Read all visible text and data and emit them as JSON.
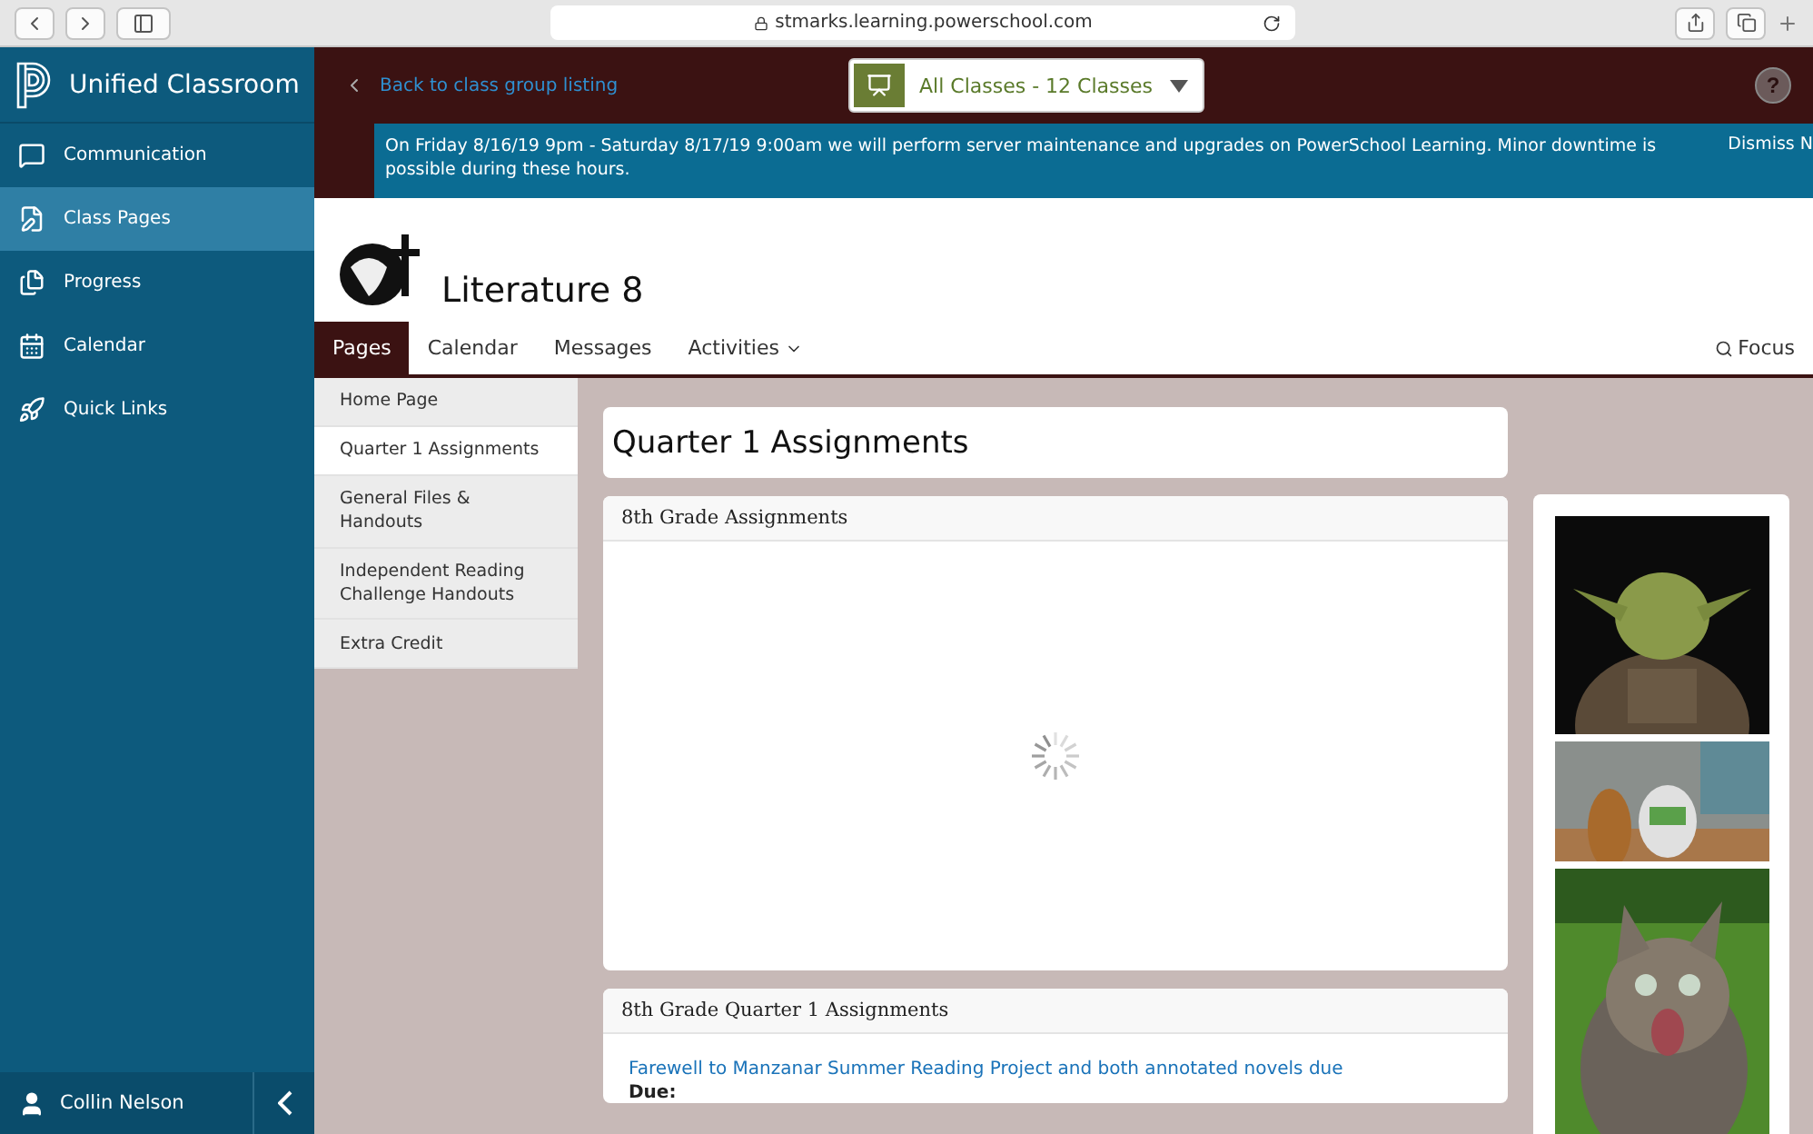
{
  "browser": {
    "url": "stmarks.learning.powerschool.com"
  },
  "sidebar": {
    "title": "Unified Classroom",
    "items": [
      {
        "label": "Communication",
        "selected": false
      },
      {
        "label": "Class Pages",
        "selected": true
      },
      {
        "label": "Progress",
        "selected": false
      },
      {
        "label": "Calendar",
        "selected": false
      },
      {
        "label": "Quick Links",
        "selected": false
      }
    ],
    "user": "Collin Nelson"
  },
  "topbar": {
    "back_link": "Back to class group listing",
    "class_picker": "All Classes - 12 Classes",
    "help": "?"
  },
  "banner": {
    "message": "On Friday 8/16/19 9pm - Saturday 8/17/19 9:00am we will perform server maintenance and upgrades on PowerSchool Learning. Minor downtime is possible during these hours.",
    "dismiss": "Dismiss N"
  },
  "class": {
    "title": "Literature 8"
  },
  "tabs": [
    {
      "label": "Pages",
      "selected": true,
      "dropdown": false
    },
    {
      "label": "Calendar",
      "selected": false,
      "dropdown": false
    },
    {
      "label": "Messages",
      "selected": false,
      "dropdown": false
    },
    {
      "label": "Activities",
      "selected": false,
      "dropdown": true
    }
  ],
  "focus": "Focus",
  "pages": [
    {
      "label": "Home Page",
      "selected": false
    },
    {
      "label": "Quarter 1 Assignments",
      "selected": true
    },
    {
      "label": "General Files & Handouts",
      "selected": false
    },
    {
      "label": "Independent Reading Challenge Handouts",
      "selected": false
    },
    {
      "label": "Extra Credit",
      "selected": false
    }
  ],
  "page_title": "Quarter 1 Assignments",
  "panels": [
    {
      "title": "8th Grade Assignments",
      "loading": true
    },
    {
      "title": "8th Grade Quarter 1 Assignments",
      "loading": false,
      "items": [
        {
          "link": "Farewell to Manzanar Summer Reading Project and both annotated novels due",
          "due_label": "Due:"
        }
      ]
    }
  ]
}
